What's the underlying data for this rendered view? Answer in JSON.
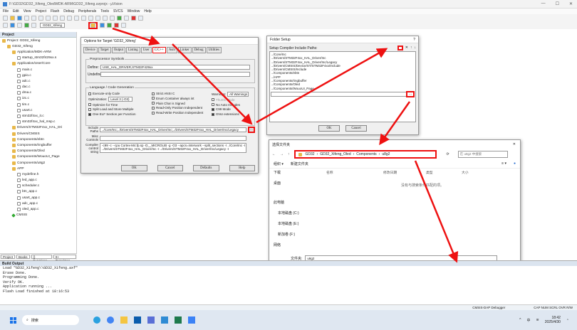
{
  "window": {
    "title": "F:\\GD32\\GD32_Xifeng_Oled\\MDK-ARM\\GD32_Xifeng.uvprojx - µVision",
    "min": "—",
    "max": "☐",
    "close": "✕"
  },
  "menu": [
    "File",
    "Edit",
    "View",
    "Project",
    "Flash",
    "Debug",
    "Peripherals",
    "Tools",
    "SVCS",
    "Window",
    "Help"
  ],
  "toolbar": {
    "target": "GD32_Xifeng"
  },
  "project": {
    "header": "Project",
    "items": [
      {
        "t": "Project: GD32_Xifeng",
        "d": 0,
        "i": "fold"
      },
      {
        "t": "GD32_Xifeng",
        "d": 1,
        "i": "fold"
      },
      {
        "t": "Application/MDK-ARM",
        "d": 2,
        "i": "fold"
      },
      {
        "t": "startup_stm32f429xx.s",
        "d": 3,
        "i": "file"
      },
      {
        "t": "Application/User/Core",
        "d": 2,
        "i": "fold"
      },
      {
        "t": "main.c",
        "d": 3,
        "i": "file"
      },
      {
        "t": "gpio.c",
        "d": 3,
        "i": "file"
      },
      {
        "t": "adc.c",
        "d": 3,
        "i": "file"
      },
      {
        "t": "dac.c",
        "d": 3,
        "i": "file"
      },
      {
        "t": "dma.c",
        "d": 3,
        "i": "file"
      },
      {
        "t": "i2c.c",
        "d": 3,
        "i": "file"
      },
      {
        "t": "tim.c",
        "d": 3,
        "i": "file"
      },
      {
        "t": "usart.c",
        "d": 3,
        "i": "file"
      },
      {
        "t": "stm32f4xx_it.c",
        "d": 3,
        "i": "file"
      },
      {
        "t": "stm32f4xx_hal_msp.c",
        "d": 3,
        "i": "file"
      },
      {
        "t": "Drivers/STM32F4xx_HAL_Dri",
        "d": 2,
        "i": "fold"
      },
      {
        "t": "Drivers/CMSIS",
        "d": 2,
        "i": "fold"
      },
      {
        "t": "Components/ebtn",
        "d": 2,
        "i": "fold"
      },
      {
        "t": "Components/ringbuffer",
        "d": 2,
        "i": "fold"
      },
      {
        "t": "Components/Oled",
        "d": 2,
        "i": "fold"
      },
      {
        "t": "Components/WouoUI_Page",
        "d": 2,
        "i": "fold"
      },
      {
        "t": "Components/u8g2",
        "d": 2,
        "i": "fold"
      },
      {
        "t": "APP",
        "d": 2,
        "i": "fold"
      },
      {
        "t": "mydefine.h",
        "d": 3,
        "i": "file"
      },
      {
        "t": "led_app.c",
        "d": 3,
        "i": "file"
      },
      {
        "t": "scheduler.c",
        "d": 3,
        "i": "file"
      },
      {
        "t": "btn_app.c",
        "d": 3,
        "i": "file"
      },
      {
        "t": "usart_app.c",
        "d": 3,
        "i": "file"
      },
      {
        "t": "adc_app.c",
        "d": 3,
        "i": "file"
      },
      {
        "t": "oled_app.c",
        "d": 3,
        "i": "file"
      },
      {
        "t": "CMSIS",
        "d": 2,
        "i": "dia"
      }
    ],
    "tabs": [
      "Project",
      "Books",
      "{} Functions",
      "0+ Templates"
    ]
  },
  "output": {
    "header": "Build Output",
    "lines": [
      "Load \"GD32_Xifeng\\\\GD32_Xifeng.axf\"",
      "Erase Done.",
      "Programming Done.",
      "Verify OK.",
      "Application running ...",
      "Flash Load finished at 18:16:53"
    ]
  },
  "status": {
    "debugger": "CMSIS-DAP Debugger",
    "caps": "CAP  NUM  SCRL  OVR  R/W"
  },
  "options": {
    "title": "Options for Target 'GD32_Xifeng'",
    "tabs": [
      "Device",
      "Target",
      "Output",
      "Listing",
      "User",
      "C/C++",
      "Asm",
      "Linker",
      "Debug",
      "Utilities"
    ],
    "preproc_label": "Preprocessor Symbols",
    "define_label": "Define:",
    "define_value": "USE_HAL_DRIVER,STM32F429xx",
    "undefine_label": "Undefine:",
    "lang_label": "Language / Code Generation",
    "checks_left": [
      "Execute-only Code",
      "Optimize for Time",
      "Split Load and Store Multiple",
      "One ELF Section per Function"
    ],
    "optimization_label": "Optimization:",
    "optimization_value": "Level 3 (-O3)",
    "checks_mid": [
      "Strict ANSI C",
      "Enum Container always int",
      "Plain Char is Signed",
      "Read-Only Position Independent",
      "Read-Write Position Independent"
    ],
    "warnings_label": "Warnings:",
    "warnings_value": "All Warnings",
    "checks_right": [
      "Thumb Mode",
      "No Auto Includes",
      "C99 Mode",
      "GNU extensions"
    ],
    "include_label": "Include Paths",
    "include_value": "../Core/Inc;../Drivers/STM32F4xx_HAL_Driver/Inc;../Drivers/STM32F4xx_HAL_Driver/Inc/Legacy",
    "misc_label": "Misc Controls",
    "compiler_label": "Compiler control string",
    "compiler_value": "-c99 -c --cpu Cortex-M4.fp.sp -D__MICROLIB -g -O3 --apcs=interwork --split_sections -I ../Core/Inc -I ../Drivers/STM32F4xx_HAL_Driver/Inc -I ../Drivers/STM32F4xx_HAL_Driver/Inc/Legacy -I",
    "ok": "OK",
    "cancel": "Cancel",
    "defaults": "Defaults",
    "help": "Help",
    "browse": "..."
  },
  "folder_setup": {
    "title": "Folder Setup",
    "label": "Setup Compiler Include Paths:",
    "paths": [
      "../Core/Inc",
      "../Drivers/STM32F4xx_HAL_Driver/Inc",
      "../Drivers/STM32F4xx_HAL_Driver/Inc/Legacy",
      "../Drivers/CMSIS/Device/ST/STM32F4xx/Include",
      "../Drivers/CMSIS/Include",
      "../Components/ebtn",
      "../APP",
      "../Components/ringbuffer",
      "../Components/Oled",
      "../Components/WouoUI_Page"
    ],
    "ok": "OK",
    "cancel": "Cancel",
    "help_q": "?",
    "close": "✕"
  },
  "file_dialog": {
    "title": "选择文件夹",
    "path": [
      "GD32",
      "GD32_Xifeng_Oled",
      "Components",
      "u8g2"
    ],
    "search_placeholder": "在 u8g2 中搜索",
    "organize": "组织 ▾",
    "new_folder": "新建文件夹",
    "col_name": "名称",
    "col_date": "修改日期",
    "col_type": "类型",
    "col_size": "大小",
    "empty": "没有与搜索条件匹配的项。",
    "nav": [
      "下载",
      "桌面",
      "此电脑",
      "本地磁盘 (C:)",
      "本地磁盘 (E:)",
      "新加卷 (F:)",
      "网络"
    ],
    "folder_label": "文件夹:",
    "folder_value": "u8g2",
    "select": "选择文件夹",
    "cancel": "取消"
  },
  "taskbar": {
    "search": "搜索",
    "time": "18:42",
    "date": "2025/4/30",
    "lang": "中"
  },
  "accent": "#e11111"
}
